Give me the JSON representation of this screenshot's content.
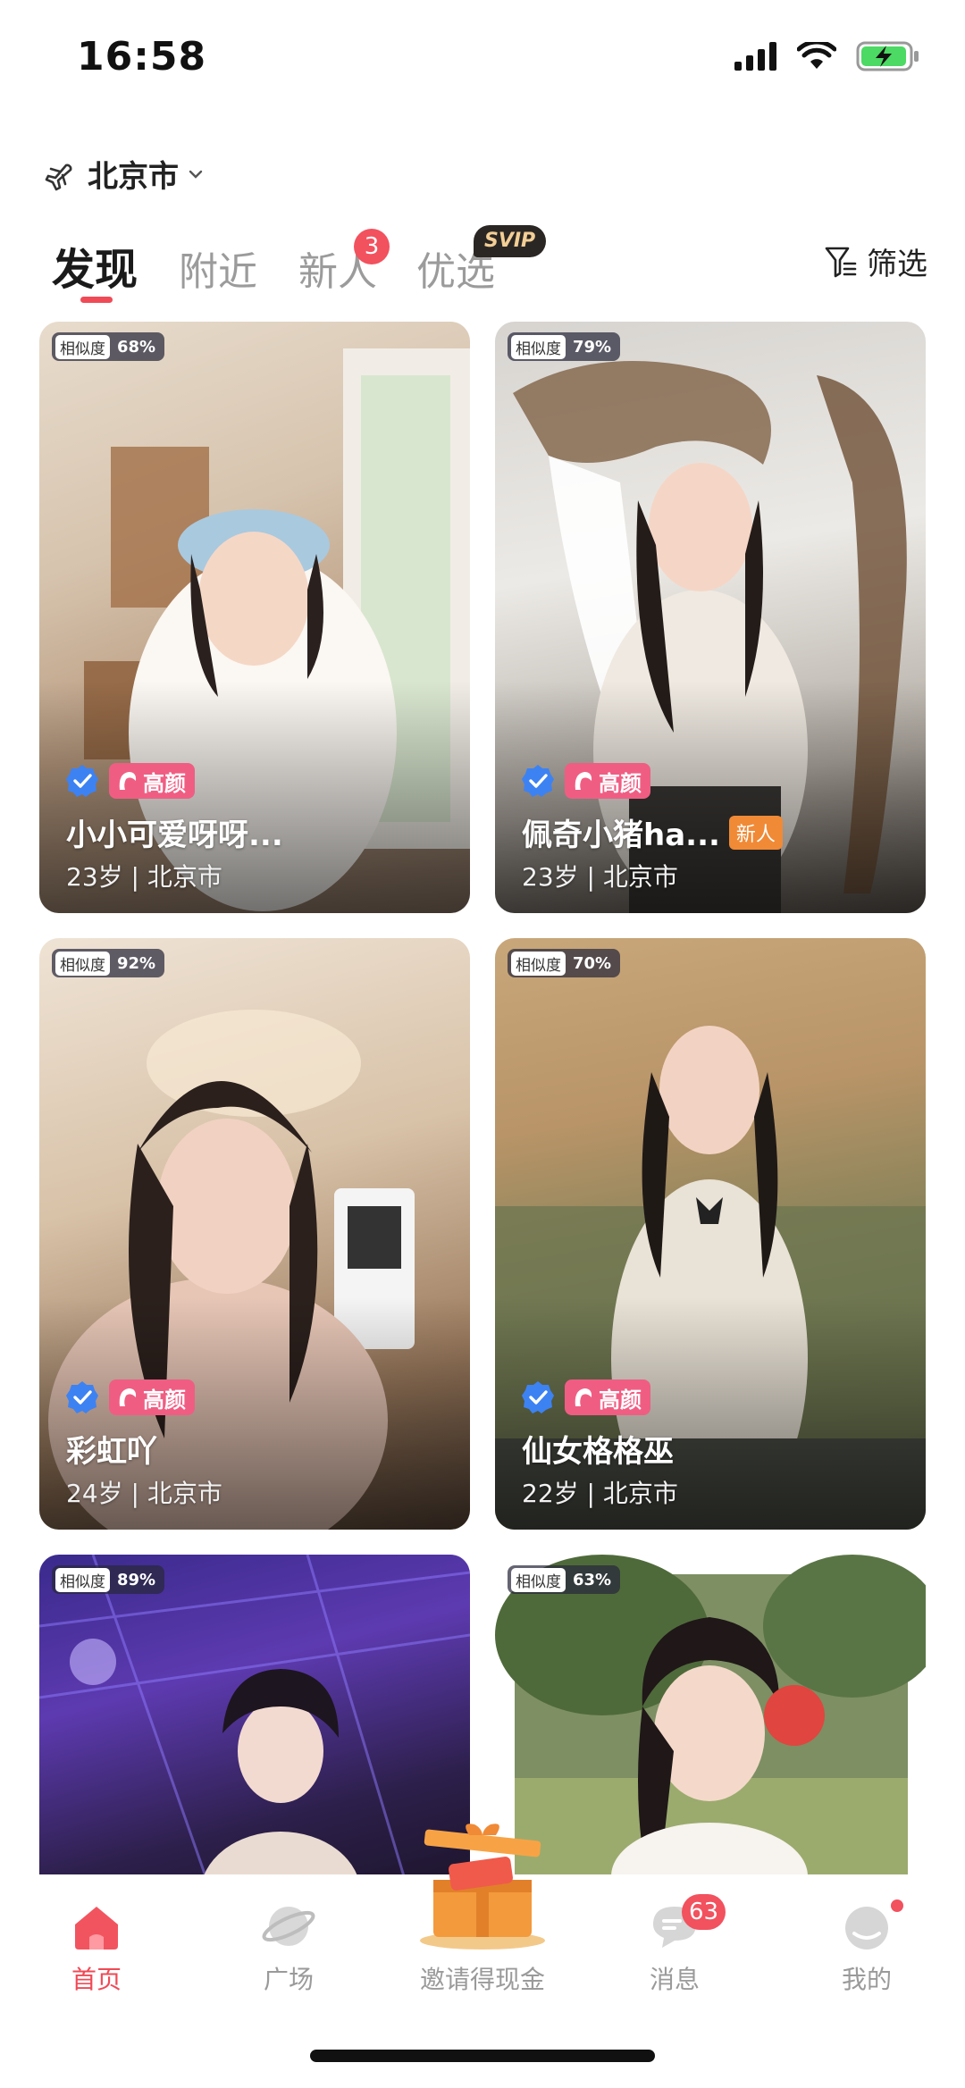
{
  "status_bar": {
    "time": "16:58"
  },
  "location": {
    "city": "北京市"
  },
  "tabs": [
    {
      "label": "发现",
      "active": true
    },
    {
      "label": "附近"
    },
    {
      "label": "新人",
      "badge": "3"
    },
    {
      "label": "优选",
      "badge": "SVIP"
    }
  ],
  "filter": {
    "label": "筛选"
  },
  "similarity_label": "相似度",
  "badge_high_looks": "高颜",
  "cards": [
    {
      "similarity": "68%",
      "name": "小小可爱呀呀...",
      "meta": "23岁 | 北京市",
      "verified": true,
      "high_looks": true,
      "new_tag": ""
    },
    {
      "similarity": "79%",
      "name": "佩奇小猪ha...",
      "meta": "23岁 | 北京市",
      "verified": true,
      "high_looks": true,
      "new_tag": "新人"
    },
    {
      "similarity": "92%",
      "name": "彩虹吖",
      "meta": "24岁 | 北京市",
      "verified": true,
      "high_looks": true,
      "new_tag": ""
    },
    {
      "similarity": "70%",
      "name": "仙女格格巫",
      "meta": "22岁 | 北京市",
      "verified": true,
      "high_looks": true,
      "new_tag": ""
    },
    {
      "similarity": "89%",
      "name": "",
      "meta": ""
    },
    {
      "similarity": "63%",
      "name": "",
      "meta": ""
    }
  ],
  "bottom_nav": [
    {
      "label": "首页",
      "icon": "home-icon",
      "active": true
    },
    {
      "label": "广场",
      "icon": "planet-icon"
    },
    {
      "label": "邀请得现金",
      "icon": "gift-box-icon"
    },
    {
      "label": "消息",
      "icon": "message-icon",
      "badge": "63"
    },
    {
      "label": "我的",
      "icon": "profile-icon",
      "dot": true
    }
  ],
  "colors": {
    "accent": "#f04a56",
    "badge_red": "#f2515e",
    "svip_gold": "#f3cf96",
    "high_looks_pink": "#f05d83",
    "verify_blue": "#3d82f2"
  }
}
